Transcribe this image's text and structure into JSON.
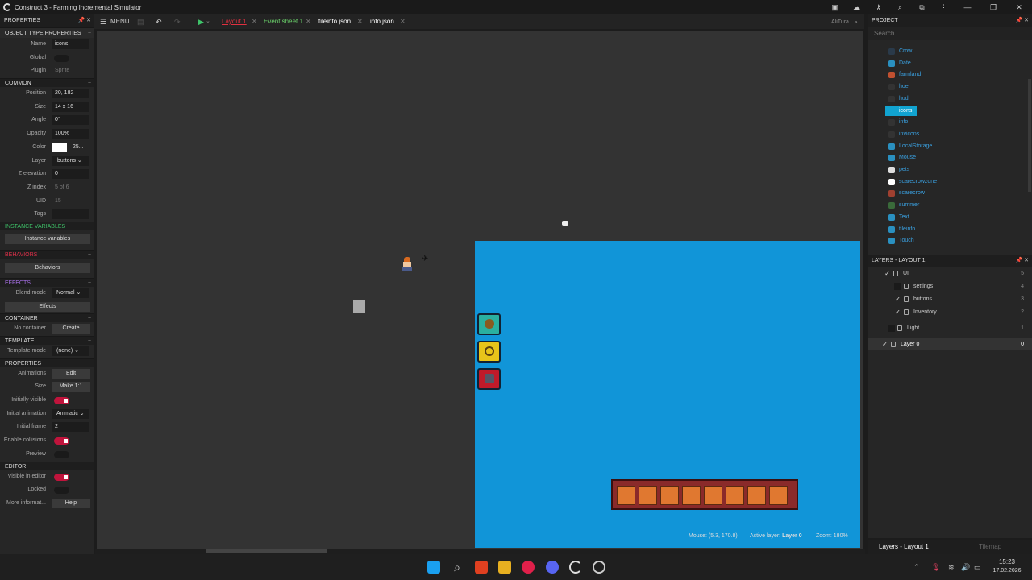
{
  "app": {
    "title": "Construct 3 - Farming Incremental Simulator"
  },
  "toolbar": {
    "menu": "MENU",
    "tabs": [
      {
        "label": "Layout 1",
        "color": "#e03040"
      },
      {
        "label": "Event sheet 1",
        "color": "#6bd36b"
      },
      {
        "label": "tileinfo.json",
        "color": "#ffffff"
      },
      {
        "label": "info.json",
        "color": "#ffffff"
      }
    ],
    "user": "AliTura"
  },
  "properties": {
    "header": "PROPERTIES",
    "object_type_section": "OBJECT TYPE PROPERTIES",
    "name_label": "Name",
    "name_value": "icons",
    "global_label": "Global",
    "plugin_label": "Plugin",
    "plugin_value": "Sprite",
    "common_section": "COMMON",
    "position_label": "Position",
    "position_value": "20, 182",
    "size_label": "Size",
    "size_value": "14 x 16",
    "angle_label": "Angle",
    "angle_value": "0°",
    "opacity_label": "Opacity",
    "opacity_value": "100%",
    "color_label": "Color",
    "color_value": "25...",
    "layer_label": "Layer",
    "layer_value": "buttons",
    "zelev_label": "Z elevation",
    "zelev_value": "0",
    "zindex_label": "Z index",
    "zindex_value": "5 of 6",
    "uid_label": "UID",
    "uid_value": "15",
    "tags_label": "Tags",
    "instvars_section": "INSTANCE VARIABLES",
    "instvars_button": "Instance variables",
    "behaviors_section": "BEHAVIORS",
    "behaviors_button": "Behaviors",
    "effects_section": "EFFECTS",
    "blend_label": "Blend mode",
    "blend_value": "Normal",
    "effects_button": "Effects",
    "container_section": "CONTAINER",
    "no_container": "No container",
    "create_button": "Create",
    "template_section": "TEMPLATE",
    "template_mode_label": "Template mode",
    "template_mode_value": "(none)",
    "props_section": "PROPERTIES",
    "animations_label": "Animations",
    "edit_button": "Edit",
    "size2_label": "Size",
    "make11_button": "Make 1:1",
    "init_visible_label": "Initially visible",
    "init_anim_label": "Initial animation",
    "init_anim_value": "Animatic",
    "init_frame_label": "Initial frame",
    "init_frame_value": "2",
    "enable_coll_label": "Enable collisions",
    "preview_label": "Preview",
    "editor_section": "EDITOR",
    "vis_editor_label": "Visible in editor",
    "locked_label": "Locked",
    "more_info_label": "More informat...",
    "help_button": "Help"
  },
  "project": {
    "header": "PROJECT",
    "search_placeholder": "Search",
    "items": [
      {
        "name": "Crow",
        "icon": "#2a3a4a"
      },
      {
        "name": "Date",
        "icon": "#2a90c0"
      },
      {
        "name": "farmland",
        "icon": "#c05030"
      },
      {
        "name": "hoe",
        "icon": "#333"
      },
      {
        "name": "hud",
        "icon": "#333"
      },
      {
        "name": "icons",
        "icon": "#a06030"
      },
      {
        "name": "info",
        "icon": "#333"
      },
      {
        "name": "invicons",
        "icon": "#333"
      },
      {
        "name": "LocalStorage",
        "icon": "#2a90c0"
      },
      {
        "name": "Mouse",
        "icon": "#2a90c0"
      },
      {
        "name": "pets",
        "icon": "#ddd"
      },
      {
        "name": "scarecrowzone",
        "icon": "#ffffff"
      },
      {
        "name": "scarecrow",
        "icon": "#a04030"
      },
      {
        "name": "summer",
        "icon": "#3a6a3a"
      },
      {
        "name": "Text",
        "icon": "#2a90c0"
      },
      {
        "name": "tileinfo",
        "icon": "#2a90c0"
      },
      {
        "name": "Touch",
        "icon": "#2a90c0"
      }
    ]
  },
  "layers": {
    "header": "LAYERS - LAYOUT 1",
    "items": [
      {
        "name": "UI",
        "num": "5"
      },
      {
        "name": "settings",
        "num": "4"
      },
      {
        "name": "buttons",
        "num": "3"
      },
      {
        "name": "Inventory",
        "num": "2"
      },
      {
        "name": "Light",
        "num": "1"
      },
      {
        "name": "Layer 0",
        "num": "0"
      }
    ],
    "tab_active": "Layers - Layout 1",
    "tab_other": "Tilemap"
  },
  "status": {
    "mouse": "Mouse: (5.3, 170.8)",
    "active_layer_label": "Active layer:",
    "active_layer": "Layer 0",
    "zoom": "Zoom: 180%"
  },
  "clock": {
    "time": "15:23",
    "date": "17.02.2026"
  }
}
